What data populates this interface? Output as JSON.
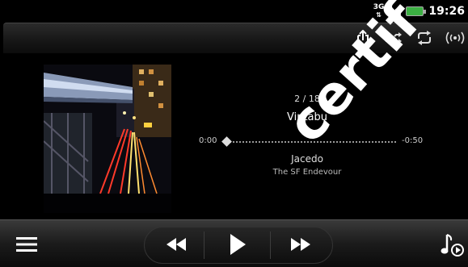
{
  "status_bar": {
    "network_type": "3G",
    "network_arrows": "⇅",
    "time": "19:26",
    "battery_color": "#3cb043"
  },
  "toolbar": {
    "icons": [
      "share-icon",
      "shuffle-icon",
      "repeat-icon",
      "broadcast-icon"
    ]
  },
  "now_playing": {
    "track_counter": "2 / 18",
    "title": "Vintabu",
    "elapsed": "0:00",
    "remaining": "-0:50",
    "progress": 0,
    "artist": "Jacedo",
    "album": "The SF Endevour"
  },
  "controls": {
    "icons": [
      "menu-icon",
      "previous-icon",
      "play-icon",
      "next-icon",
      "music-library-icon"
    ]
  },
  "watermark": {
    "text": "certif"
  }
}
